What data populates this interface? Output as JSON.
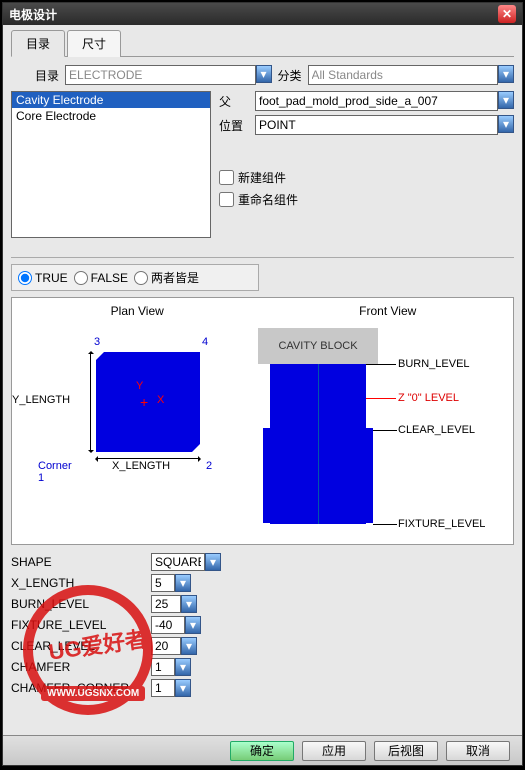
{
  "title": "电极设计",
  "tabs": {
    "catalog": "目录",
    "dimensions": "尺寸"
  },
  "top": {
    "catalog_label": "目录",
    "catalog_value": "ELECTRODE",
    "class_label": "分类",
    "class_value": "All Standards"
  },
  "list": {
    "items": [
      "Cavity Electrode",
      "Core  Electrode"
    ],
    "selected": 0
  },
  "right": {
    "parent_label": "父",
    "parent_value": "foot_pad_mold_prod_side_a_007",
    "position_label": "位置",
    "position_value": "POINT",
    "new_component": "新建组件",
    "rename_component": "重命名组件"
  },
  "radios": {
    "true": "TRUE",
    "false": "FALSE",
    "both": "两者皆是"
  },
  "diagram": {
    "plan_title": "Plan View",
    "front_title": "Front View",
    "cavity": "CAVITY BLOCK",
    "y_axis_x": "X",
    "y_axis_y": "Y",
    "ylen": "Y_LENGTH",
    "xlen": "X_LENGTH",
    "corner1": "Corner 1",
    "n3": "3",
    "n4": "4",
    "n2": "2",
    "burn": "BURN_LEVEL",
    "zlevel": "Z \"0\" LEVEL",
    "clear": "CLEAR_LEVEL",
    "fixture": "FIXTURE_LEVEL"
  },
  "params": {
    "shape_label": "SHAPE",
    "shape_value": "SQUARE",
    "xlen_label": "X_LENGTH",
    "xlen_value": "5",
    "burn_label": "BURN_LEVEL",
    "burn_value": "25",
    "fixture_label": "FIXTURE_LEVEL",
    "fixture_value": "-40",
    "clear_label": "CLEAR_LEVEL",
    "clear_value": "20",
    "chamfer_label": "CHAMFER",
    "chamfer_value": "1",
    "chamfer_corner_label": "CHAMFER_CORNER",
    "chamfer_corner_value": "1"
  },
  "footer": {
    "ok": "确定",
    "apply": "应用",
    "backview": "后视图",
    "cancel": "取消"
  },
  "watermark": {
    "text": "WWW.UGSNX.COM",
    "brand": "UG爱好者"
  }
}
